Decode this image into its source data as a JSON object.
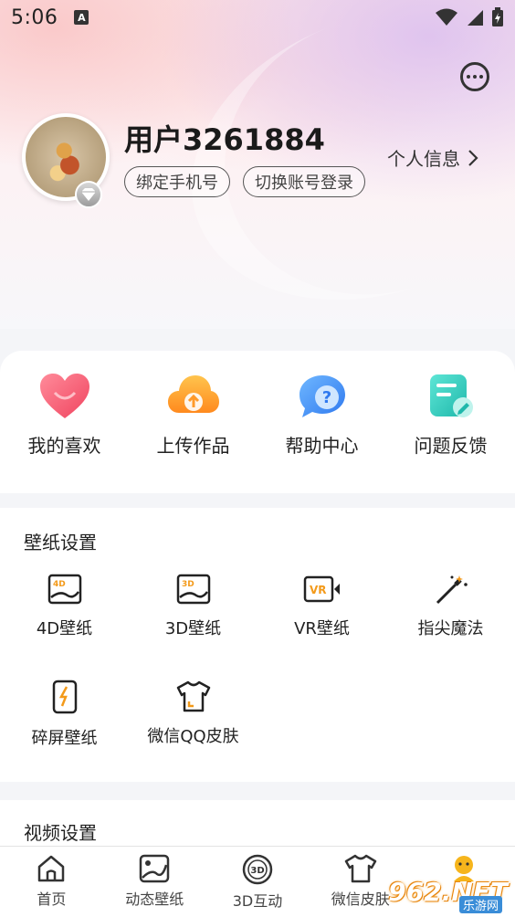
{
  "status_bar": {
    "time": "5:06",
    "notification_letter": "A"
  },
  "profile": {
    "username": "用户3261884",
    "bind_phone_label": "绑定手机号",
    "switch_account_label": "切换账号登录",
    "profile_link_label": "个人信息"
  },
  "quick_actions": [
    {
      "label": "我的喜欢",
      "icon": "heart-icon"
    },
    {
      "label": "上传作品",
      "icon": "cloud-upload-icon"
    },
    {
      "label": "帮助中心",
      "icon": "help-bubble-icon"
    },
    {
      "label": "问题反馈",
      "icon": "feedback-note-icon"
    }
  ],
  "wallpaper_settings": {
    "title": "壁纸设置",
    "items": [
      {
        "label": "4D壁纸",
        "icon": "4d-wallpaper-icon",
        "badge": "4D"
      },
      {
        "label": "3D壁纸",
        "icon": "3d-wallpaper-icon",
        "badge": "3D"
      },
      {
        "label": "VR壁纸",
        "icon": "vr-wallpaper-icon",
        "badge": "VR"
      },
      {
        "label": "指尖魔法",
        "icon": "magic-wand-icon"
      },
      {
        "label": "碎屏壁纸",
        "icon": "broken-screen-icon"
      },
      {
        "label": "微信QQ皮肤",
        "icon": "tshirt-icon"
      }
    ]
  },
  "video_settings": {
    "title": "视频设置"
  },
  "tab_bar": [
    {
      "label": "首页",
      "icon": "home-icon"
    },
    {
      "label": "动态壁纸",
      "icon": "dynamic-wallpaper-icon"
    },
    {
      "label": "3D互动",
      "icon": "3d-interact-icon",
      "badge": "3D"
    },
    {
      "label": "微信皮肤",
      "icon": "tshirt-icon"
    },
    {
      "label": "",
      "icon": "mine-icon"
    }
  ],
  "watermark": {
    "text": "962.NET",
    "sub": "乐游网"
  },
  "colors": {
    "accent": "#f39a1a",
    "text": "#222222",
    "background": "#f4f5f8"
  }
}
